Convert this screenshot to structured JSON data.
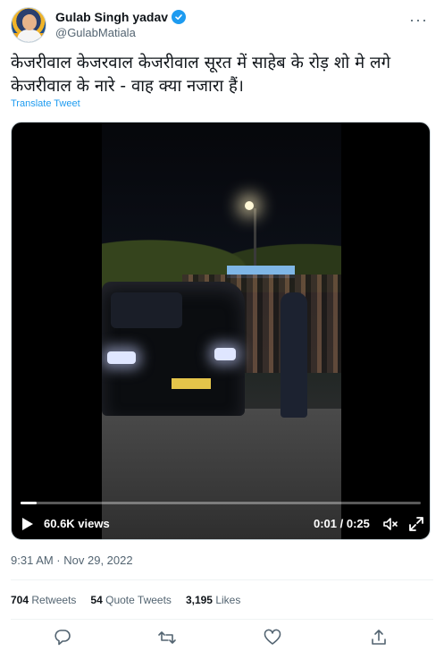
{
  "author": {
    "display_name": "Gulab Singh yadav",
    "handle": "@GulabMatiala",
    "avatar_icon": "profile-photo",
    "verified_icon": "verified-badge-icon",
    "verified_color": "#1d9bf0"
  },
  "tweet": {
    "text": "केजरीवाल केजरवाल केजरीवाल सूरत में साहेब के रोड़ शो मे लगे केजरीवाल के नारे - वाह क्या नजारा हैं।",
    "translate_label": "Translate Tweet",
    "timestamp": "9:31 AM · Nov 29, 2022"
  },
  "video": {
    "views": "60.6K views",
    "time": "0:01 / 0:25",
    "progress_fraction": 0.04,
    "play_icon": "play-icon",
    "mute_icon": "volume-mute-icon",
    "fullscreen_icon": "expand-icon"
  },
  "stats": {
    "retweets_count": "704",
    "retweets_label": "Retweets",
    "quotes_count": "54",
    "quotes_label": "Quote Tweets",
    "likes_count": "3,195",
    "likes_label": "Likes"
  },
  "actions": {
    "reply_icon": "reply-icon",
    "retweet_icon": "retweet-icon",
    "like_icon": "heart-icon",
    "share_icon": "share-icon"
  },
  "colors": {
    "accent": "#1d9bf0",
    "secondary_text": "#536471",
    "divider": "#eff3f4"
  }
}
